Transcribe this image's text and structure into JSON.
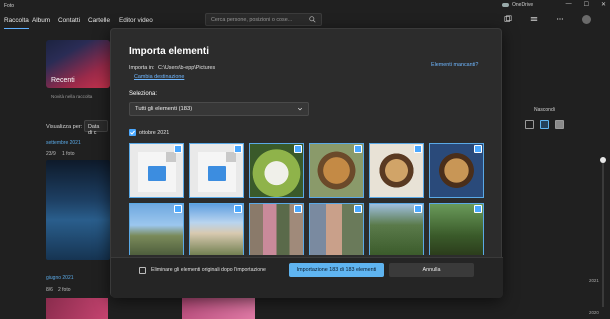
{
  "window": {
    "title": "Foto",
    "onedrive_label": "OneDrive"
  },
  "nav": {
    "tabs": [
      {
        "label": "Raccolta"
      },
      {
        "label": "Album"
      },
      {
        "label": "Contatti"
      },
      {
        "label": "Cartelle"
      },
      {
        "label": "Editor video"
      }
    ],
    "search_placeholder": "Cerca persone, posizioni o cose..."
  },
  "background": {
    "recent_label": "Recenti",
    "recent_sub": "Novità nella raccolta",
    "view_for_label": "Visualizza per:",
    "view_for_value": "Data di c",
    "groups": [
      {
        "month": "settembre 2021",
        "day": "23/9",
        "count": "1 foto"
      },
      {
        "month": "giugno 2021",
        "day": "8/6",
        "count": "2 foto"
      }
    ],
    "hide_label": "Nascondi",
    "timeline_years": [
      "2021",
      "2020"
    ]
  },
  "modal": {
    "title": "Importa elementi",
    "import_in_label": "Importa in:",
    "import_path": "C:\\Users\\b-epp\\Pictures",
    "change_dest": "Cambia destinazione",
    "missing_items": "Elementi mancanti?",
    "select_label": "Seleziona:",
    "select_value": "Tutti gli elementi (183)",
    "month_group": "ottobre 2021",
    "delete_originals": "Eliminare gli elementi originali dopo l'importazione",
    "import_button": "Importazione 183 di 183 elementi",
    "cancel_button": "Annulla"
  },
  "colors": {
    "accent": "#5fb4f0",
    "link": "#6fb7ff"
  }
}
